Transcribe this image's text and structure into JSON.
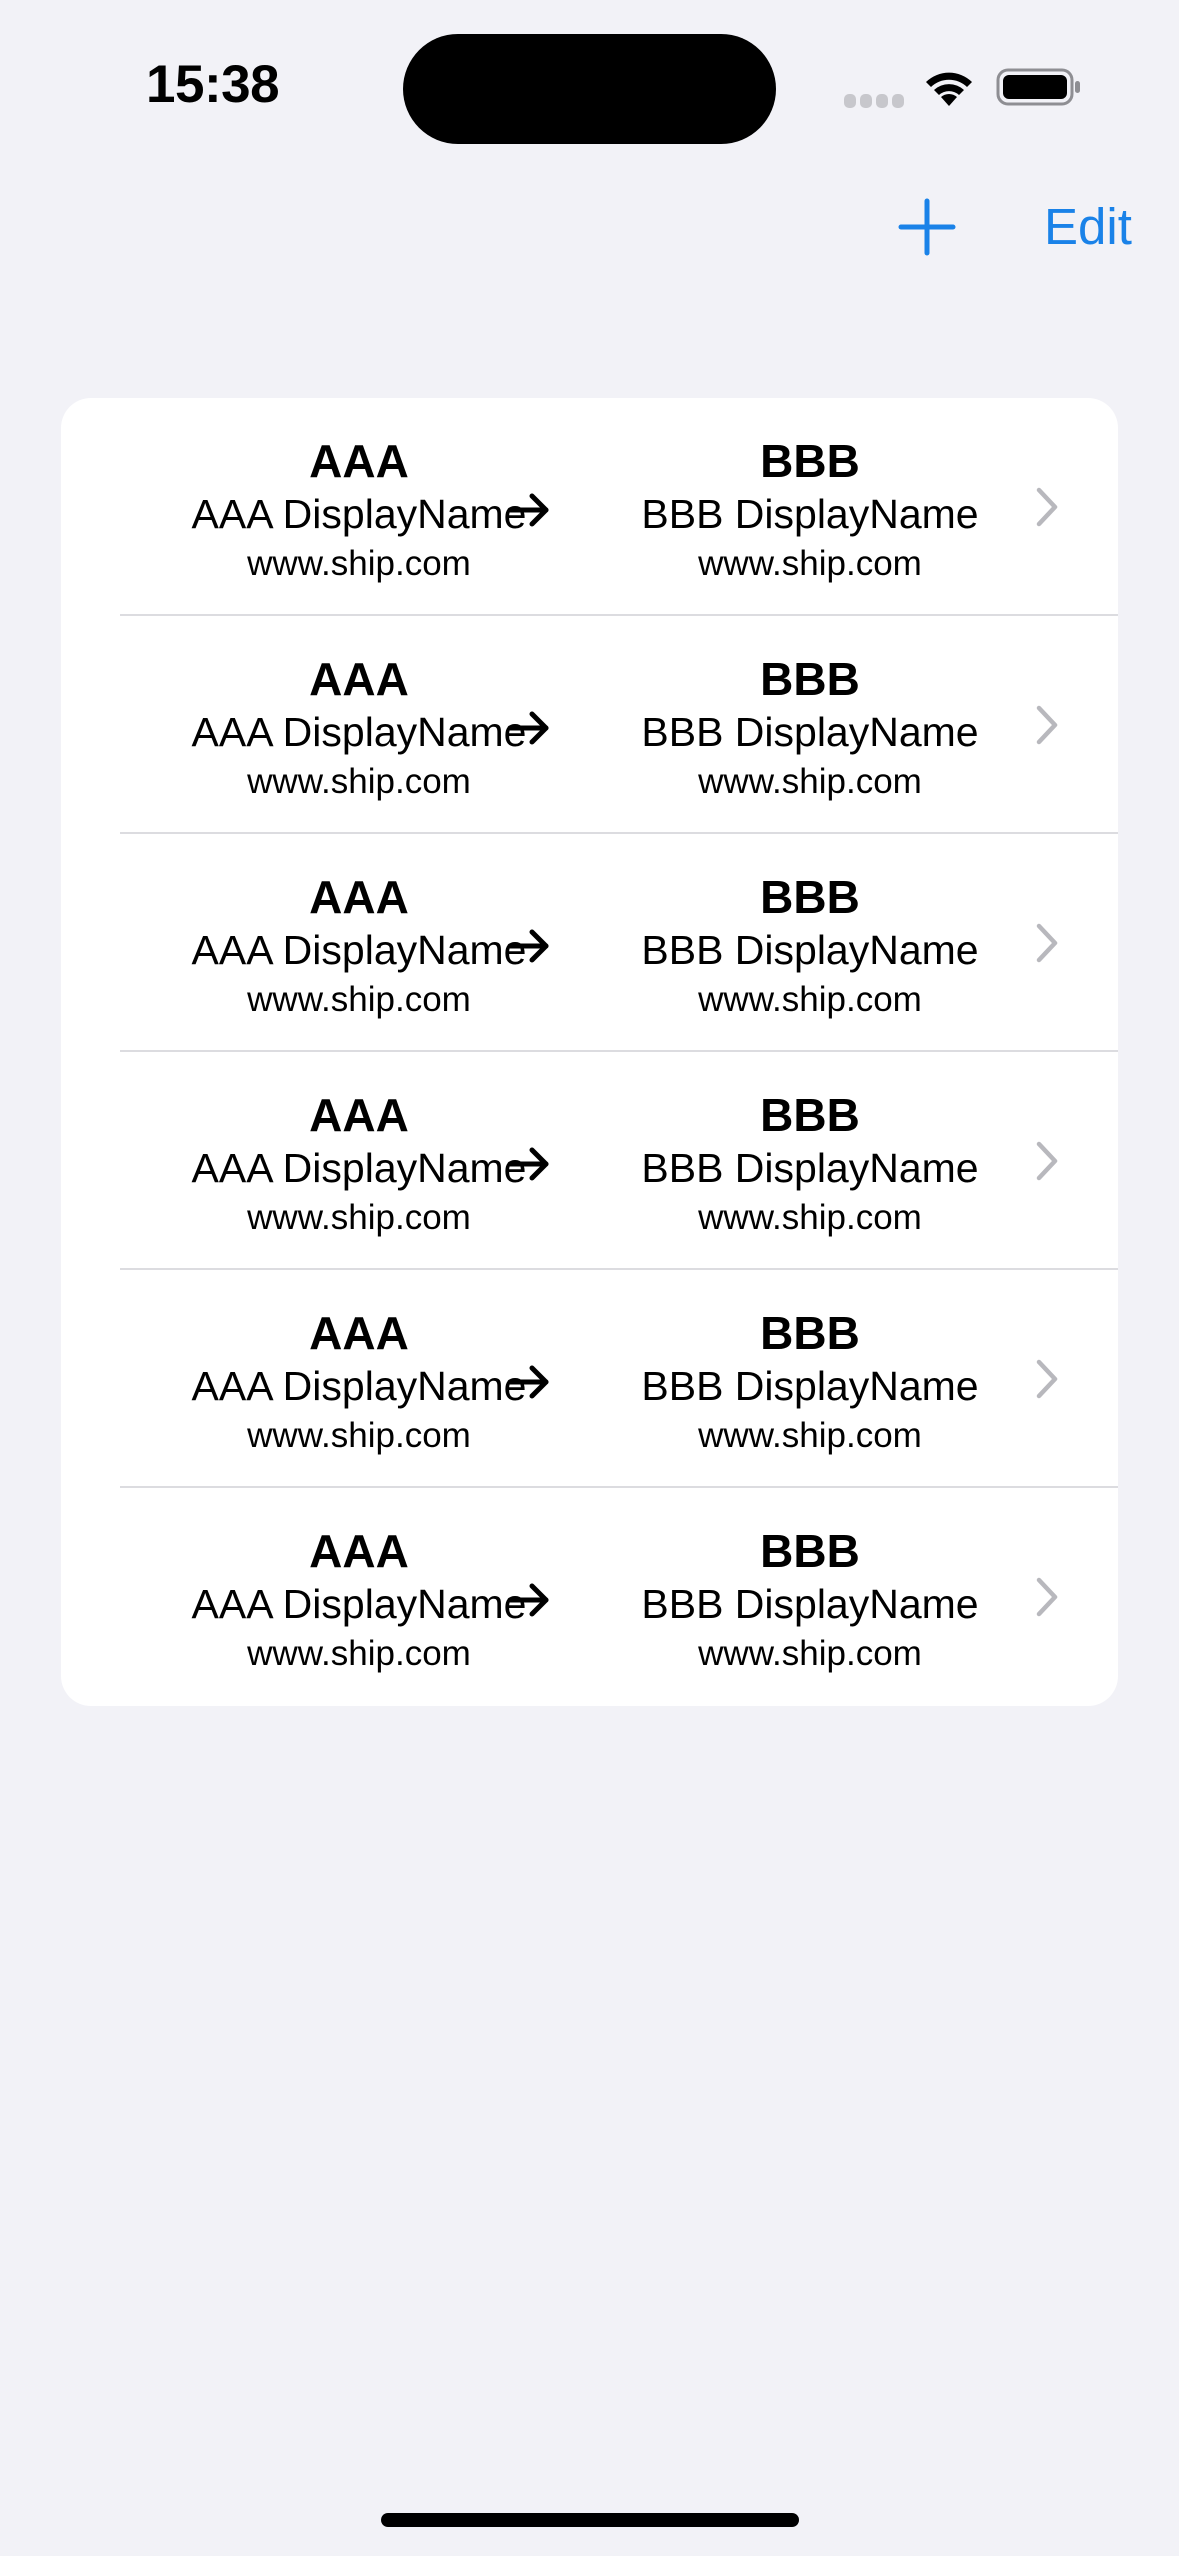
{
  "status_bar": {
    "time": "15:38",
    "icons": [
      "cellular-signal-icon",
      "wifi-icon",
      "battery-icon"
    ]
  },
  "nav": {
    "add_icon": "plus-icon",
    "edit_label": "Edit",
    "accent_color": "#1a82e8"
  },
  "rows": [
    {
      "from_code": "AAA",
      "from_display": "AAA DisplayName",
      "from_url": "www.ship.com",
      "to_code": "BBB",
      "to_display": "BBB DisplayName",
      "to_url": "www.ship.com"
    },
    {
      "from_code": "AAA",
      "from_display": "AAA DisplayName",
      "from_url": "www.ship.com",
      "to_code": "BBB",
      "to_display": "BBB DisplayName",
      "to_url": "www.ship.com"
    },
    {
      "from_code": "AAA",
      "from_display": "AAA DisplayName",
      "from_url": "www.ship.com",
      "to_code": "BBB",
      "to_display": "BBB DisplayName",
      "to_url": "www.ship.com"
    },
    {
      "from_code": "AAA",
      "from_display": "AAA DisplayName",
      "from_url": "www.ship.com",
      "to_code": "BBB",
      "to_display": "BBB DisplayName",
      "to_url": "www.ship.com"
    },
    {
      "from_code": "AAA",
      "from_display": "AAA DisplayName",
      "from_url": "www.ship.com",
      "to_code": "BBB",
      "to_display": "BBB DisplayName",
      "to_url": "www.ship.com"
    },
    {
      "from_code": "AAA",
      "from_display": "AAA DisplayName",
      "from_url": "www.ship.com",
      "to_code": "BBB",
      "to_display": "BBB DisplayName",
      "to_url": "www.ship.com"
    }
  ],
  "row_icons": {
    "arrow": "arrow-right-icon",
    "chevron": "chevron-right-icon"
  }
}
